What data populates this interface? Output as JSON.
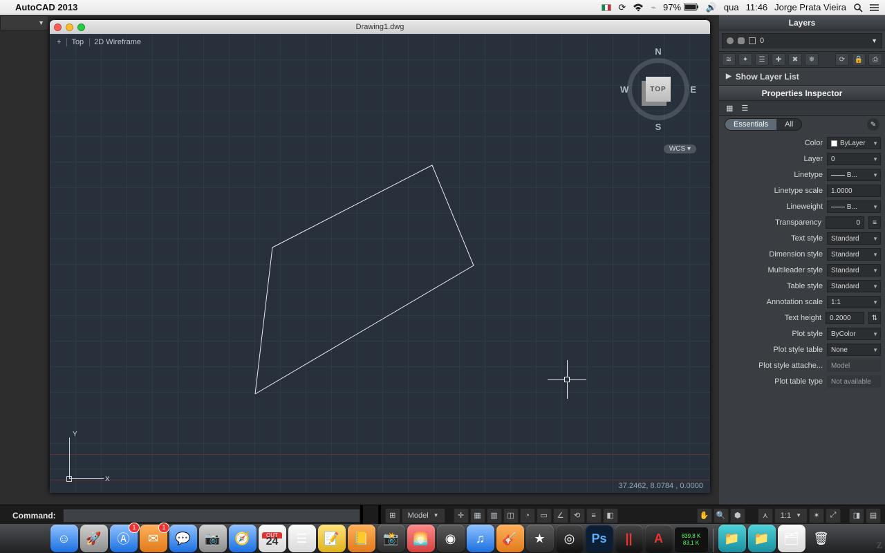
{
  "menubar": {
    "app_name": "AutoCAD 2013",
    "battery": "97%",
    "day": "qua",
    "time": "11:46",
    "user": "Jorge Prata Vieira"
  },
  "docwin": {
    "title": "Drawing1.dwg",
    "view_labels": {
      "a": "+",
      "b": "Top",
      "c": "2D Wireframe"
    },
    "viewcube": {
      "face": "TOP",
      "n": "N",
      "s": "S",
      "e": "E",
      "w": "W"
    },
    "wcs": "WCS ▾",
    "ucs": {
      "x": "X",
      "y": "Y"
    },
    "coords": "37.2462, 8.0784 , 0.0000"
  },
  "layers_panel": {
    "title": "Layers",
    "current": "0",
    "show_list": "Show Layer List"
  },
  "inspector": {
    "title": "Properties Inspector",
    "tab_essentials": "Essentials",
    "tab_all": "All",
    "rows": {
      "color": {
        "label": "Color",
        "value": "ByLayer"
      },
      "layer": {
        "label": "Layer",
        "value": "0"
      },
      "linetype": {
        "label": "Linetype",
        "value": "B..."
      },
      "lt_scale": {
        "label": "Linetype scale",
        "value": "1.0000"
      },
      "lineweight": {
        "label": "Lineweight",
        "value": "B..."
      },
      "transparency": {
        "label": "Transparency",
        "value": "0"
      },
      "text_style": {
        "label": "Text style",
        "value": "Standard"
      },
      "dim_style": {
        "label": "Dimension style",
        "value": "Standard"
      },
      "ml_style": {
        "label": "Multileader style",
        "value": "Standard"
      },
      "tbl_style": {
        "label": "Table style",
        "value": "Standard"
      },
      "anno_scale": {
        "label": "Annotation scale",
        "value": "1:1"
      },
      "text_height": {
        "label": "Text height",
        "value": "0.2000"
      },
      "plot_style": {
        "label": "Plot style",
        "value": "ByColor"
      },
      "plot_table": {
        "label": "Plot style table",
        "value": "None"
      },
      "plot_attach": {
        "label": "Plot style attache...",
        "value": "Model"
      },
      "plot_type": {
        "label": "Plot table type",
        "value": "Not available"
      }
    }
  },
  "cmdbar": {
    "prompt": "Command:",
    "input": ""
  },
  "status": {
    "model": "Model",
    "anno": "1:1"
  },
  "dock": {
    "net_up": "839,8 K",
    "net_down": "83,1 K",
    "app_store_badge": "1",
    "mail_badge": "1",
    "cal_month": "OUT",
    "cal_day": "24"
  }
}
